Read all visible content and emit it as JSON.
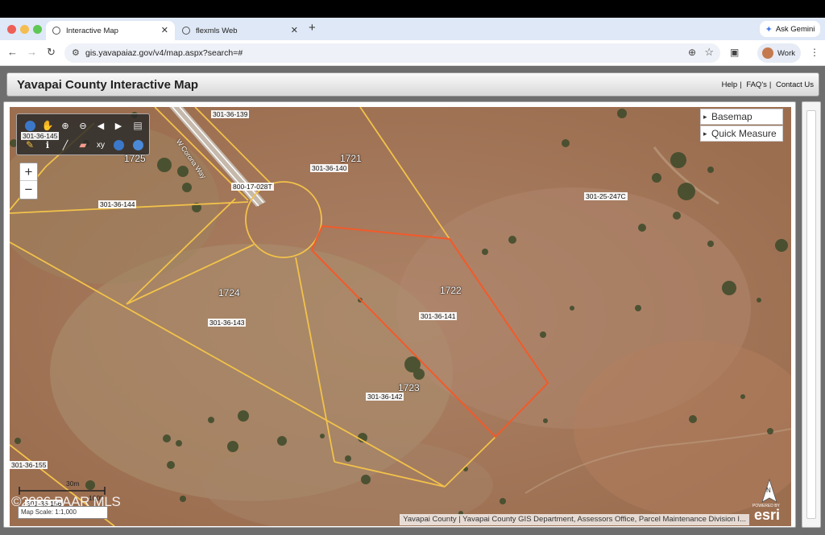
{
  "browser": {
    "tabs": [
      {
        "label": "Interactive Map"
      },
      {
        "label": "flexmls Web"
      }
    ],
    "new_tab": "+",
    "ask_gemini": "Ask Gemini",
    "url": "gis.yavapaiaz.gov/v4/map.aspx?search=#",
    "profile": "Work"
  },
  "header": {
    "title": "Yavapai County Interactive Map",
    "links": [
      "Help",
      "FAQ's",
      "Contact Us"
    ]
  },
  "map": {
    "widgets": [
      "Basemap",
      "Quick Measure"
    ],
    "zoom_in": "+",
    "zoom_out": "−",
    "tools_xy": "xy",
    "street": "W Corona Way",
    "parcels": [
      "301-36-139",
      "301-36-140",
      "301-36-144",
      "301-25-247C",
      "800-17-028T",
      "301-36-143",
      "301-36-141",
      "301-36-142",
      "301-36-155",
      "301-36-156",
      "301-36-145"
    ],
    "lots": [
      "1721",
      "1724",
      "1722",
      "1723",
      "1725"
    ],
    "scale_m": "30m",
    "scale_ft": "100ft",
    "map_scale_label": "Map Scale:",
    "map_scale_value": "1:1,000",
    "attribution": "Yavapai County | Yavapai County GIS Department, Assessors Office, Parcel Maintenance Division I...",
    "powered_by": "POWERED BY",
    "esri": "esri",
    "north": "N",
    "watermark": "©2026 PAAR MLS",
    "colors": {
      "parcel_line": "#f2c24a",
      "selected_parcel": "#f25a2a"
    }
  }
}
